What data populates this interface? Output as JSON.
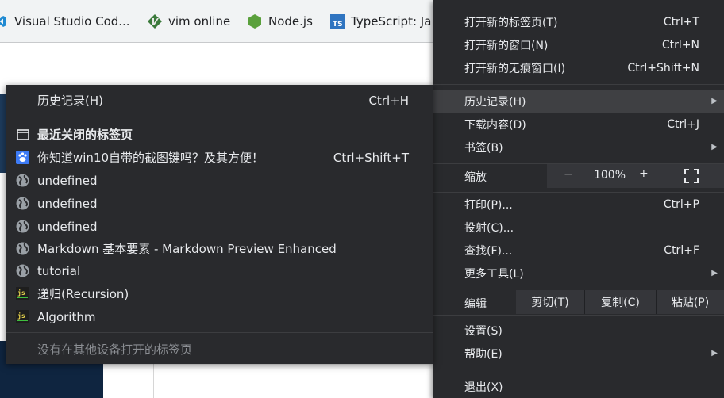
{
  "bookmarks": [
    {
      "label": "Visual Studio Cod...",
      "icon": "vscode-icon"
    },
    {
      "label": "vim online",
      "icon": "vim-icon"
    },
    {
      "label": "Node.js",
      "icon": "nodejs-icon"
    },
    {
      "label": "TypeScript: Ja",
      "icon": "typescript-icon"
    }
  ],
  "main_menu": {
    "new_tab": {
      "label": "打开新的标签页(T)",
      "shortcut": "Ctrl+T"
    },
    "new_window": {
      "label": "打开新的窗口(N)",
      "shortcut": "Ctrl+N"
    },
    "new_incognito": {
      "label": "打开新的无痕窗口(I)",
      "shortcut": "Ctrl+Shift+N"
    },
    "history": {
      "label": "历史记录(H)"
    },
    "downloads": {
      "label": "下载内容(D)",
      "shortcut": "Ctrl+J"
    },
    "bookmarks": {
      "label": "书签(B)"
    },
    "zoom": {
      "label": "缩放",
      "minus": "−",
      "value": "100%",
      "plus": "+"
    },
    "print": {
      "label": "打印(P)...",
      "shortcut": "Ctrl+P"
    },
    "cast": {
      "label": "投射(C)..."
    },
    "find": {
      "label": "查找(F)...",
      "shortcut": "Ctrl+F"
    },
    "more_tools": {
      "label": "更多工具(L)"
    },
    "edit": {
      "label": "编辑",
      "cut": "剪切(T)",
      "copy": "复制(C)",
      "paste": "粘贴(P)"
    },
    "settings": {
      "label": "设置(S)"
    },
    "help": {
      "label": "帮助(E)"
    },
    "exit": {
      "label": "退出(X)"
    }
  },
  "history_menu": {
    "header": {
      "label": "历史记录(H)",
      "shortcut": "Ctrl+H"
    },
    "recently_closed": "最近关闭的标签页",
    "items": [
      {
        "label": "你知道win10自带的截图键吗？及其方便！",
        "shortcut": "Ctrl+Shift+T",
        "icon": "baidu-icon"
      },
      {
        "label": "undefined",
        "icon": "globe-icon"
      },
      {
        "label": "undefined",
        "icon": "globe-icon"
      },
      {
        "label": "undefined",
        "icon": "globe-icon"
      },
      {
        "label": "Markdown 基本要素 - Markdown Preview Enhanced",
        "icon": "globe-icon"
      },
      {
        "label": "tutorial",
        "icon": "globe-icon"
      },
      {
        "label": "递归(Recursion)",
        "icon": "js-icon"
      },
      {
        "label": "Algorithm",
        "icon": "js-icon"
      }
    ],
    "no_other_devices": "没有在其他设备打开的标签页"
  },
  "colors": {
    "menu_bg": "#292a2d",
    "highlight": "#3f4043",
    "text": "#e8eaed",
    "muted": "#8b8e93",
    "bookmarks_bg": "#f1f3f4"
  }
}
